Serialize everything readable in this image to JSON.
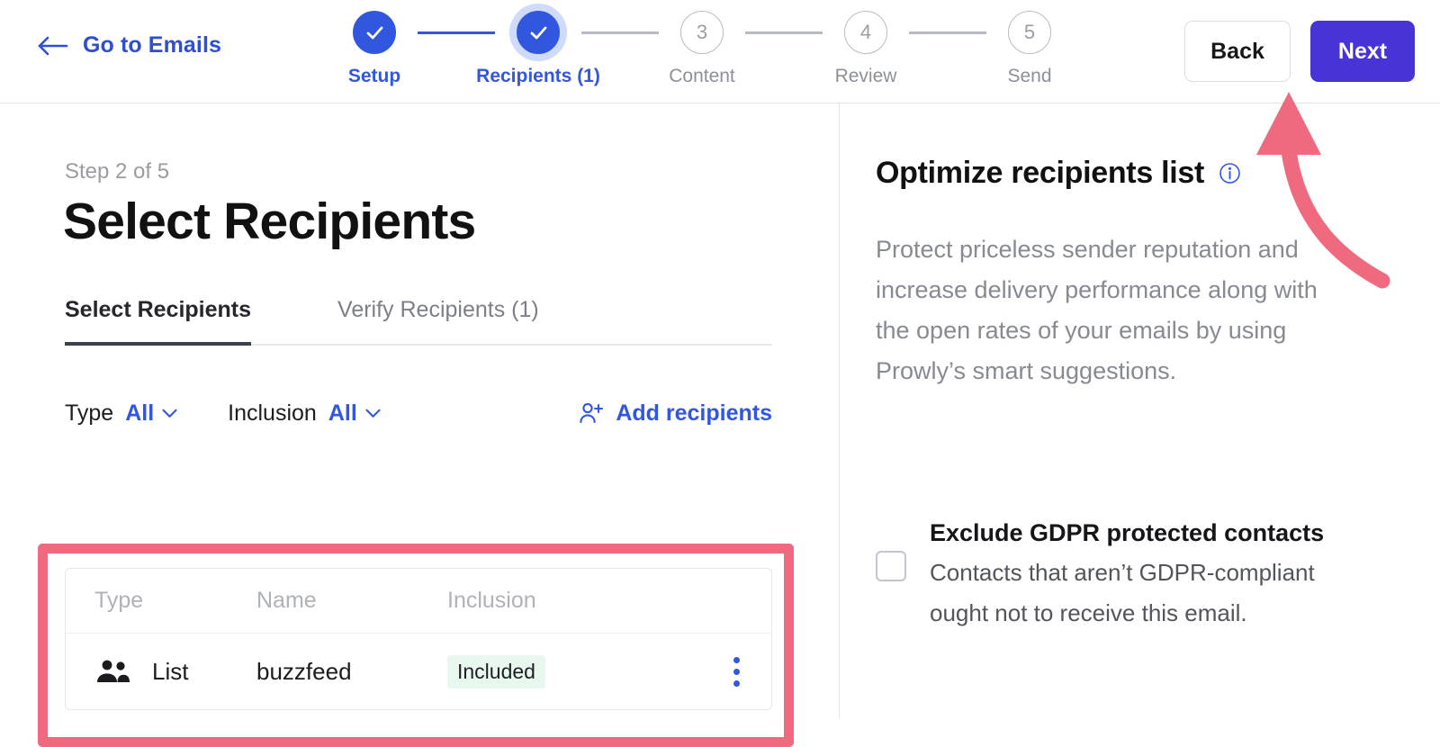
{
  "header": {
    "back_link_label": "Go to Emails",
    "back_icon": "arrow-left-icon",
    "buttons": {
      "back_label": "Back",
      "next_label": "Next"
    },
    "stepper": [
      {
        "num": "1",
        "label": "Setup",
        "state": "done"
      },
      {
        "num": "2",
        "label": "Recipients (1)",
        "state": "current"
      },
      {
        "num": "3",
        "label": "Content",
        "state": "todo"
      },
      {
        "num": "4",
        "label": "Review",
        "state": "todo"
      },
      {
        "num": "5",
        "label": "Send",
        "state": "todo"
      }
    ]
  },
  "main": {
    "step_count": "Step 2 of 5",
    "title": "Select Recipients",
    "tabs": [
      {
        "label": "Select Recipients",
        "active": true
      },
      {
        "label": "Verify Recipients (1)",
        "active": false
      }
    ],
    "filters": [
      {
        "label": "Type",
        "value": "All"
      },
      {
        "label": "Inclusion",
        "value": "All"
      }
    ],
    "add_recipients_label": "Add recipients",
    "add_recipients_icon": "person-add-icon",
    "table": {
      "columns": [
        "Type",
        "Name",
        "Inclusion"
      ],
      "rows": [
        {
          "type_icon": "group-icon",
          "type": "List",
          "name": "buzzfeed",
          "inclusion": "Included",
          "menu_icon": "kebab-menu-icon"
        }
      ]
    }
  },
  "sidebar": {
    "title": "Optimize recipients list",
    "info_icon": "info-circle-icon",
    "description": "Protect priceless sender reputation and increase delivery performance along with the open rates of your emails by using Prowly’s smart suggestions.",
    "gdpr": {
      "title": "Exclude GDPR protected contacts",
      "description": "Contacts that aren’t GDPR-compliant ought not to receive this email.",
      "checked": false
    }
  },
  "annotation": {
    "arrow_color": "#ef6a7e",
    "highlight_color": "#ef6a7e",
    "arrow_target": "Next",
    "highlight_target": "recipients-table"
  },
  "colors": {
    "primary_blue": "#3257df",
    "next_purple": "#4733d6",
    "badge_green_bg": "#e9f8ef",
    "annotation_pink": "#ef6a7e"
  }
}
